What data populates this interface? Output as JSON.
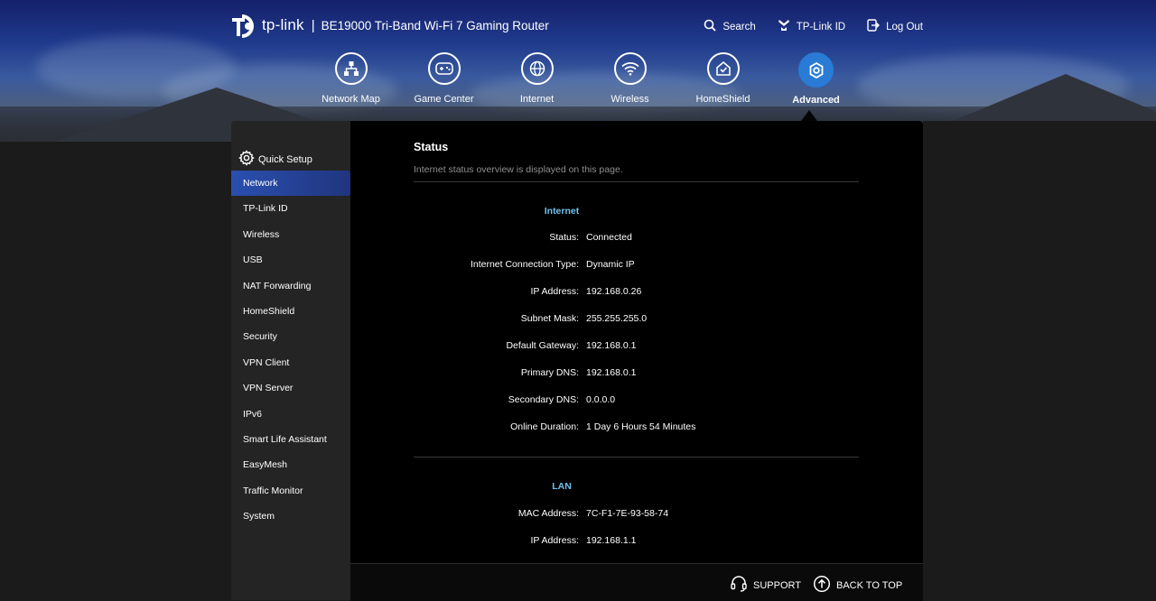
{
  "header": {
    "brand": "tp-link",
    "separator": "|",
    "product": "BE19000 Tri-Band Wi-Fi 7 Gaming Router",
    "links": [
      {
        "label": "Search",
        "icon": "search-icon"
      },
      {
        "label": "TP-Link ID",
        "icon": "user-id-icon"
      },
      {
        "label": "Log Out",
        "icon": "logout-icon"
      }
    ]
  },
  "nav": [
    {
      "label": "Network Map",
      "icon": "network-map-icon"
    },
    {
      "label": "Game Center",
      "icon": "gamepad-icon"
    },
    {
      "label": "Internet",
      "icon": "globe-icon"
    },
    {
      "label": "Wireless",
      "icon": "wifi-icon"
    },
    {
      "label": "HomeShield",
      "icon": "homeshield-icon"
    },
    {
      "label": "Advanced",
      "icon": "gear-icon",
      "active": true
    }
  ],
  "sidebar": {
    "quick_setup": "Quick Setup",
    "items": [
      {
        "label": "Network",
        "selected": true
      },
      {
        "label": "TP-Link ID"
      },
      {
        "label": "Wireless"
      },
      {
        "label": "USB"
      },
      {
        "label": "NAT Forwarding"
      },
      {
        "label": "HomeShield"
      },
      {
        "label": "Security"
      },
      {
        "label": "VPN Client"
      },
      {
        "label": "VPN Server"
      },
      {
        "label": "IPv6"
      },
      {
        "label": "Smart Life Assistant"
      },
      {
        "label": "EasyMesh"
      },
      {
        "label": "Traffic Monitor"
      },
      {
        "label": "System"
      }
    ]
  },
  "main": {
    "title": "Status",
    "description": "Internet status overview is displayed on this page.",
    "internet": {
      "title": "Internet",
      "rows": [
        {
          "label": "Status:",
          "value": "Connected"
        },
        {
          "label": "Internet Connection Type:",
          "value": "Dynamic IP"
        },
        {
          "label": "IP Address:",
          "value": "192.168.0.26"
        },
        {
          "label": "Subnet Mask:",
          "value": "255.255.255.0"
        },
        {
          "label": "Default Gateway:",
          "value": "192.168.0.1"
        },
        {
          "label": "Primary DNS:",
          "value": "192.168.0.1"
        },
        {
          "label": "Secondary DNS:",
          "value": "0.0.0.0"
        },
        {
          "label": "Online Duration:",
          "value": "1 Day 6 Hours 54 Minutes"
        }
      ]
    },
    "lan": {
      "title": "LAN",
      "rows": [
        {
          "label": "MAC Address:",
          "value": "7C-F1-7E-93-58-74"
        },
        {
          "label": "IP Address:",
          "value": "192.168.1.1"
        }
      ]
    }
  },
  "footer": {
    "support": "SUPPORT",
    "back_to_top": "BACK TO TOP"
  },
  "colors": {
    "accent_blue": "#2a7bd6",
    "section_title": "#6fc1ec",
    "selected_menu": "#2a4fb0"
  }
}
